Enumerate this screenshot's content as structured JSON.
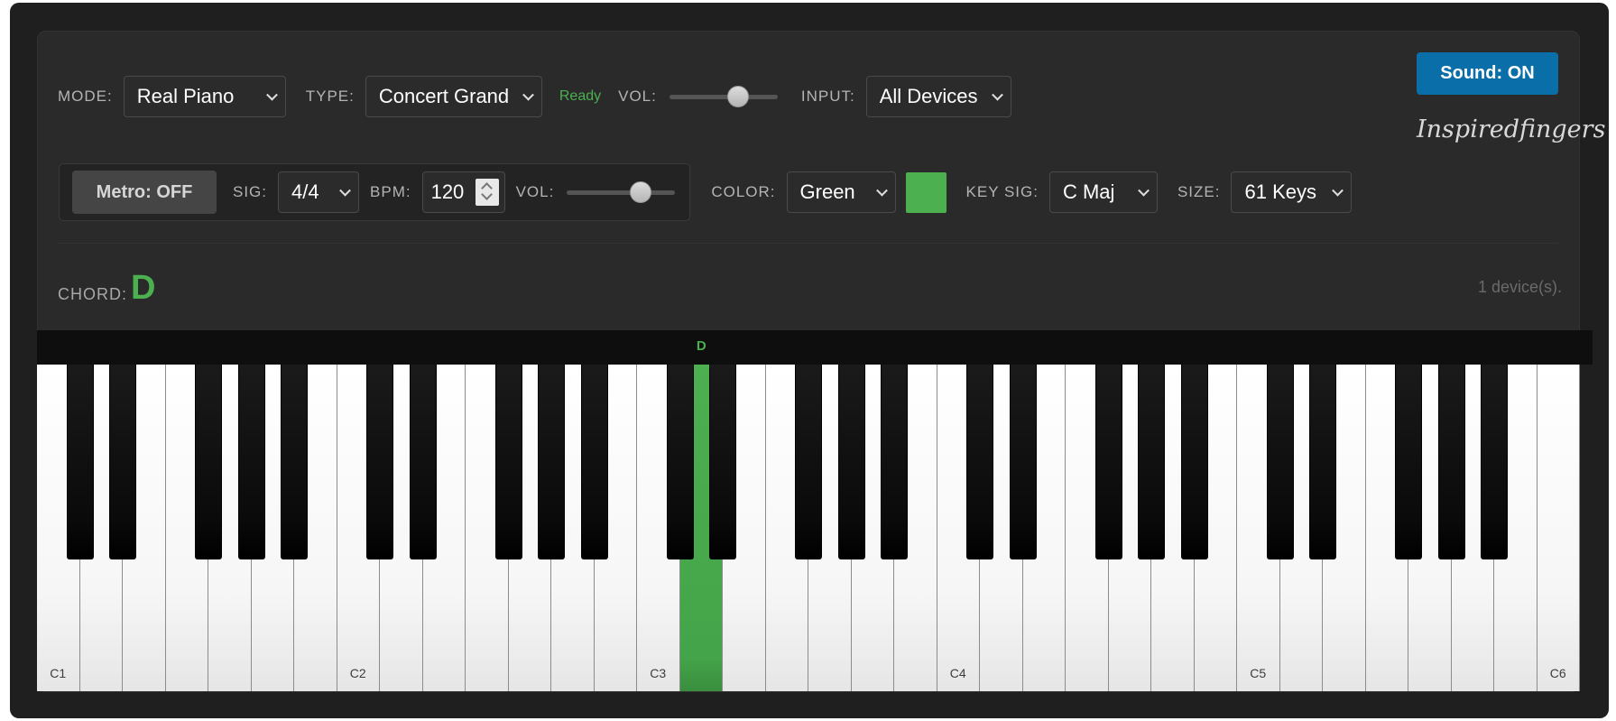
{
  "toolbar": {
    "mode_label": "MODE:",
    "mode_value": "Real Piano",
    "type_label": "TYPE:",
    "type_value": "Concert Grand",
    "status": "Ready",
    "vol_label": "VOL:",
    "vol_level": 0.67,
    "input_label": "INPUT:",
    "input_value": "All Devices",
    "sound_button": "Sound: ON",
    "brand": "Inspiredfingers"
  },
  "metronome": {
    "button": "Metro: OFF",
    "sig_label": "SIG:",
    "sig_value": "4/4",
    "bpm_label": "BPM:",
    "bpm_value": "120",
    "vol_label": "VOL:",
    "vol_level": 0.73
  },
  "display": {
    "color_label": "COLOR:",
    "color_value": "Green",
    "color_swatch": "#4caf50",
    "keysig_label": "KEY SIG:",
    "keysig_value": "C Maj",
    "size_label": "SIZE:",
    "size_value": "61 Keys"
  },
  "chord": {
    "label": "CHORD:",
    "value": "D",
    "devices": "1 device(s)."
  },
  "keyboard": {
    "octave_labels": [
      "C1",
      "C2",
      "C3",
      "C4",
      "C5",
      "C6"
    ],
    "active_note": "D",
    "active_white_index": 15,
    "white_key_count": 36
  }
}
